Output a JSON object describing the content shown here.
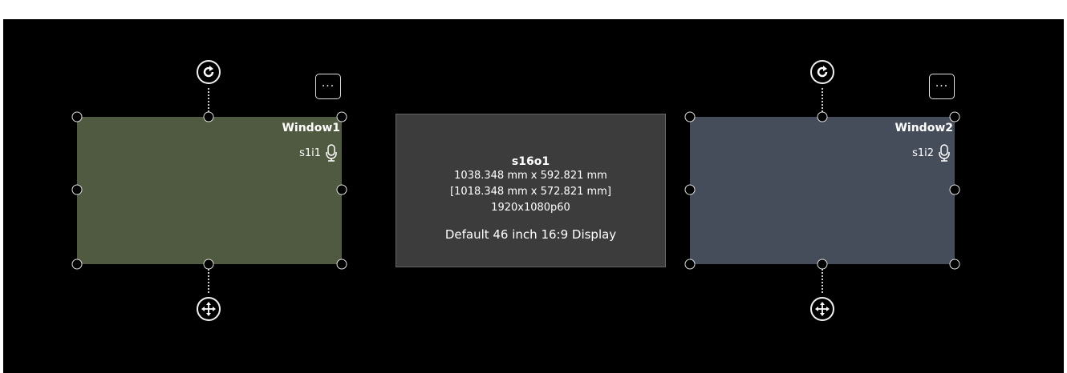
{
  "windows": [
    {
      "title": "Window1",
      "source": "s1i1",
      "color": "#4f5a40"
    },
    {
      "title": "Window2",
      "source": "s1i2",
      "color": "#464d5a"
    }
  ],
  "display": {
    "name": "s16o1",
    "size": "1038.348 mm x 592.821 mm",
    "inner_size": "[1018.348 mm x 572.821 mm]",
    "resolution": "1920x1080p60",
    "description": "Default 46 inch 16:9 Display",
    "color": "#3c3c3c"
  },
  "menu_label": "···",
  "icons": {
    "rotate": "rotate-icon",
    "move": "move-icon",
    "mic": "microphone-icon",
    "menu": "more-options-icon"
  }
}
